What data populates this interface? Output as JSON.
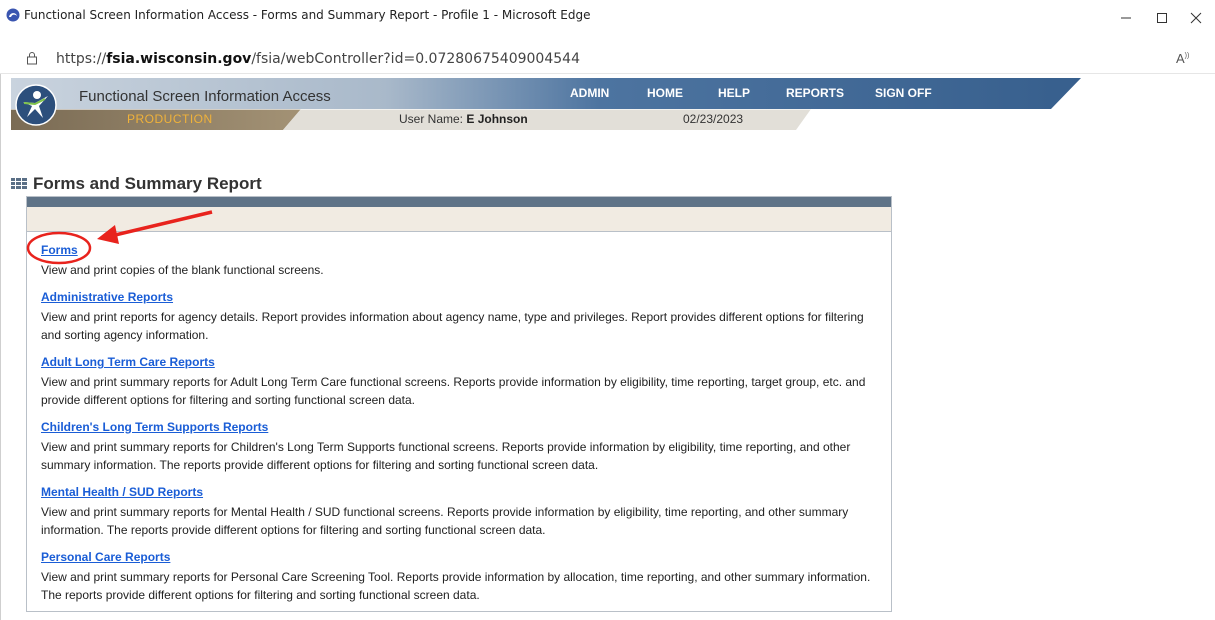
{
  "window": {
    "title": "Functional Screen Information Access - Forms and Summary Report - Profile 1 - Microsoft Edge"
  },
  "address_bar": {
    "url_prefix": "https://",
    "url_host": "fsia.wisconsin.gov",
    "url_path": "/fsia/webController?id=0.07280675409004544"
  },
  "header": {
    "app_name": "Functional Screen Information Access",
    "nav": [
      "ADMIN",
      "HOME",
      "HELP",
      "REPORTS",
      "SIGN OFF"
    ],
    "environment": "PRODUCTION",
    "user_label": "User Name:",
    "user_name": "E Johnson",
    "date": "02/23/2023"
  },
  "section": {
    "title": "Forms and Summary Report"
  },
  "items": [
    {
      "link": "Forms",
      "desc": "View and print copies of the blank functional screens."
    },
    {
      "link": "Administrative Reports",
      "desc": "View and print reports for agency details. Report provides information about agency name, type and privileges. Report provides different options for filtering and sorting agency information."
    },
    {
      "link": "Adult Long Term Care Reports",
      "desc": "View and print summary reports for Adult Long Term Care functional screens. Reports provide information by eligibility, time reporting, target group, etc. and provide different options for filtering and sorting functional screen data."
    },
    {
      "link": "Children's Long Term Supports Reports",
      "desc": "View and print summary reports for Children's Long Term Supports functional screens. Reports provide information by eligibility, time reporting, and other summary information. The reports provide different options for filtering and sorting functional screen data."
    },
    {
      "link": "Mental Health / SUD Reports",
      "desc": "View and print summary reports for Mental Health / SUD functional screens. Reports provide information by eligibility, time reporting, and other summary information. The reports provide different options for filtering and sorting functional screen data."
    },
    {
      "link": "Personal Care Reports",
      "desc": "View and print summary reports for Personal Care Screening Tool. Reports provide information by allocation, time reporting, and other summary information. The reports provide different options for filtering and sorting functional screen data."
    }
  ],
  "colors": {
    "banner_blue": "#3f6893",
    "link": "#1a5dd6",
    "production": "#f0b23a",
    "annotation_red": "#e8231d"
  }
}
